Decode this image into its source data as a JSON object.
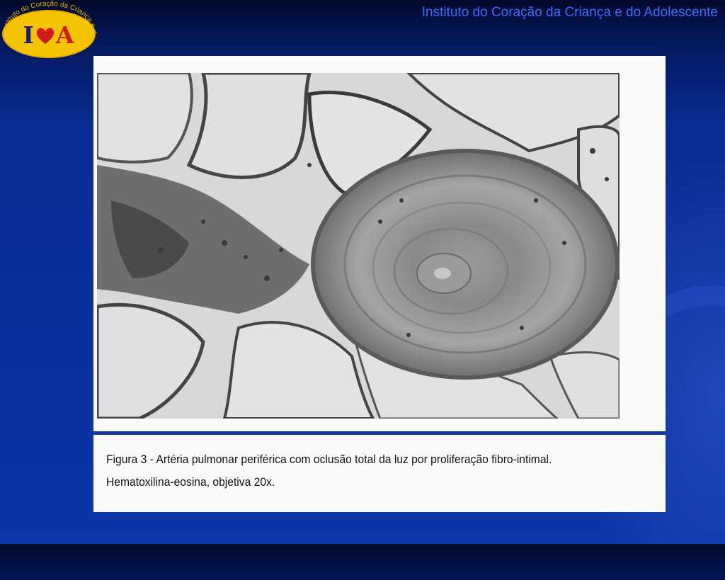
{
  "header": {
    "title": "Instituto do Coração da Criança e do Adolescente",
    "title_color": "#3d6cff"
  },
  "logo": {
    "ring_text": "Instituto do Coração da Criança e do Adolescente",
    "letter_left": "I",
    "letter_right": "A",
    "icon": "heart-icon",
    "fill_color": "#f5c400",
    "heart_color": "#d11b1b"
  },
  "figure": {
    "image": "histology-micrograph",
    "caption_line_1": "Figura 3 - Artéria pulmonar periférica com oclusão total da luz por proliferação fibro-intimal.",
    "caption_line_2": "Hematoxilina-eosina, objetiva 20x."
  },
  "colors": {
    "background_top": "#030a2a",
    "background_bottom": "#0d35a8",
    "divider": "#123a9e"
  }
}
